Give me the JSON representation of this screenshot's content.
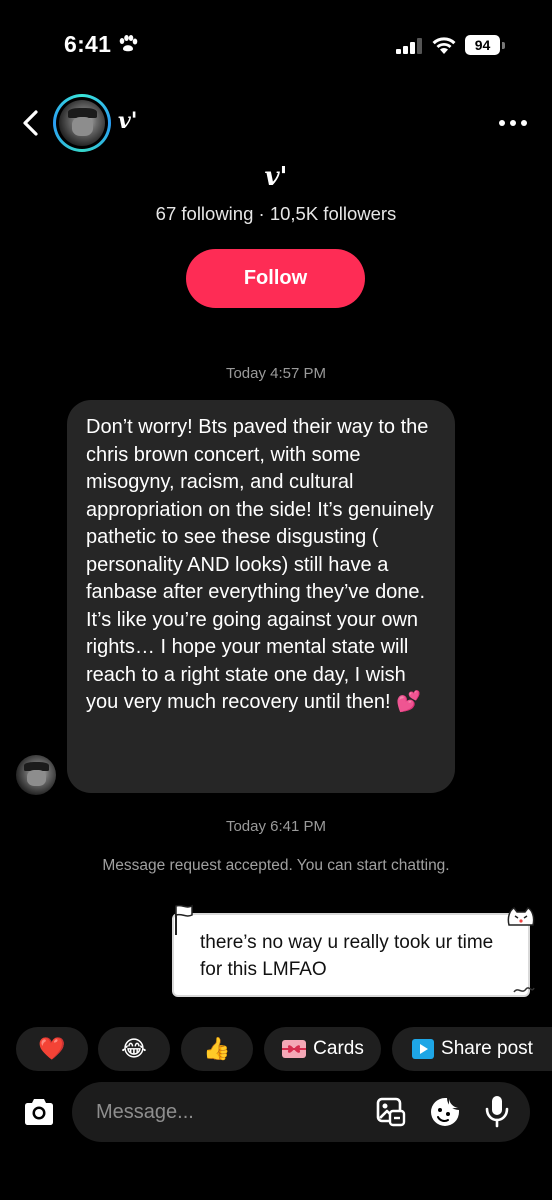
{
  "status_bar": {
    "time": "6:41",
    "battery": "94"
  },
  "header": {
    "name": "v'"
  },
  "profile": {
    "name": "v'",
    "stats": "67 following · 10,5K followers",
    "follow_label": "Follow"
  },
  "messages": {
    "timestamp_1": "Today 4:57 PM",
    "incoming_text": "Don’t worry! Bts paved their way to the chris brown concert, with some misogyny, racism, and cultural appropriation on the side! It’s genuinely pathetic to see these disgusting ( personality AND looks) still have a fanbase after everything they’ve done. It’s like you’re going against your own rights… I hope your mental state will reach to a right state one day, I wish you very much recovery until then! 💕",
    "timestamp_2": "Today 6:41 PM",
    "system_text": "Message request accepted. You can start chatting.",
    "outgoing_text": "there’s no way u really took ur time for this LMFAO"
  },
  "quick_replies": [
    {
      "emoji": "❤️"
    },
    {
      "emoji": "😂"
    },
    {
      "emoji": "👍"
    },
    {
      "label": "Cards",
      "icon": "gift-card-icon"
    },
    {
      "label": "Share post",
      "icon": "share-post-icon"
    }
  ],
  "composer": {
    "placeholder": "Message..."
  },
  "colors": {
    "follow": "#fe2c55",
    "bubble_in": "#262626",
    "chip": "#1f1f1f"
  }
}
